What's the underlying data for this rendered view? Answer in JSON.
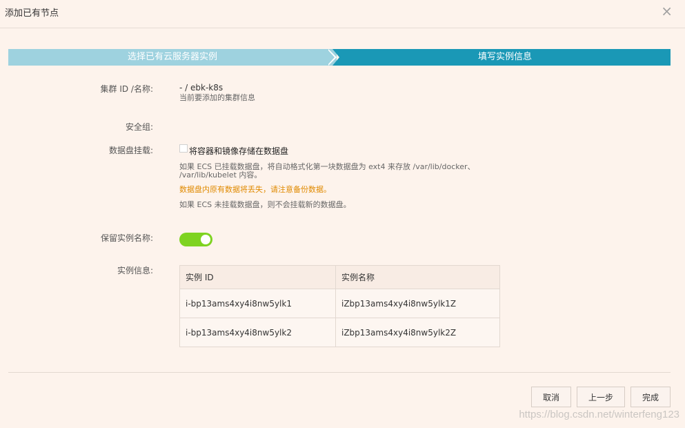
{
  "dialog": {
    "title": "添加已有节点",
    "close_symbol": "×"
  },
  "steps": [
    {
      "label": "选择已有云服务器实例",
      "state": "done"
    },
    {
      "label": "填写实例信息",
      "state": "active"
    }
  ],
  "form": {
    "cluster": {
      "label": "集群 ID /名称:",
      "value": "- / ebk-k8s",
      "hint": "当前要添加的集群信息"
    },
    "security_group": {
      "label": "安全组:"
    },
    "data_disk": {
      "label": "数据盘挂载:",
      "checkbox_label": "将容器和镜像存储在数据盘",
      "checked": false,
      "hint_line1": "如果 ECS 已挂载数据盘，将自动格式化第一块数据盘为 ext4 来存放 /var/lib/docker、",
      "hint_line2": "/var/lib/kubelet 内容。",
      "warning": "数据盘内原有数据将丢失，请注意备份数据。",
      "hint_line3": "如果 ECS 未挂载数据盘，则不会挂载新的数据盘。"
    },
    "keep_name": {
      "label": "保留实例名称:",
      "enabled": true
    },
    "instances": {
      "label": "实例信息:",
      "columns": [
        "实例 ID",
        "实例名称"
      ],
      "rows": [
        [
          "i-bp13ams4xy4i8nw5ylk1",
          "iZbp13ams4xy4i8nw5ylk1Z"
        ],
        [
          "i-bp13ams4xy4i8nw5ylk2",
          "iZbp13ams4xy4i8nw5ylk2Z"
        ]
      ]
    }
  },
  "footer": {
    "cancel_label": "取消",
    "prev_label": "上一步",
    "finish_label": "完成"
  },
  "watermark": "https://blog.csdn.net/winterfeng123",
  "colors": {
    "step_done": "#9ed2df",
    "step_active": "#1a98b6",
    "toggle_on": "#7ed321",
    "warning": "#e08a00",
    "background": "#fdf3ec"
  }
}
